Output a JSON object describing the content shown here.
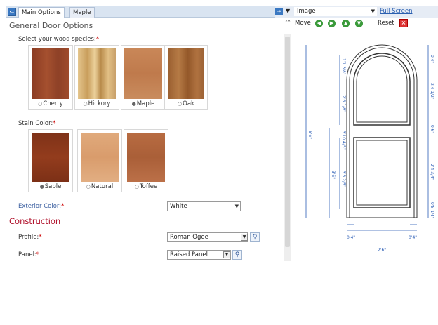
{
  "tabs": [
    {
      "label": "Main Options",
      "active": true
    },
    {
      "label": "Maple",
      "active": false
    }
  ],
  "section_title": "General Door Options",
  "species": {
    "label": "Select your wood species:",
    "required_mark": "*",
    "options": [
      {
        "label": "Cherry",
        "selected": false,
        "color": "#9a4a2a"
      },
      {
        "label": "Hickory",
        "selected": false,
        "color": "#d7b47a"
      },
      {
        "label": "Maple",
        "selected": true,
        "color": "#c9885a"
      },
      {
        "label": "Oak",
        "selected": false,
        "color": "#a86b3a"
      }
    ]
  },
  "stain": {
    "label": "Stain Color:",
    "required_mark": "*",
    "options": [
      {
        "label": "Sable",
        "selected": true,
        "color": "#8a3a1e"
      },
      {
        "label": "Natural",
        "selected": false,
        "color": "#dba274"
      },
      {
        "label": "Toffee",
        "selected": false,
        "color": "#b56a42"
      }
    ]
  },
  "exterior_color": {
    "label": "Exterior Color:",
    "required_mark": "*",
    "value": "White"
  },
  "construction": {
    "title": "Construction",
    "profile": {
      "label": "Profile:",
      "required_mark": "*",
      "value": "Roman Ogee"
    },
    "panel": {
      "label": "Panel:",
      "required_mark": "*",
      "value": "Raised Panel"
    }
  },
  "viewer": {
    "view_value": "Image",
    "full_screen": "Full Screen",
    "move_label": "Move",
    "reset_label": "Reset"
  },
  "drawing": {
    "dims": {
      "top": "0'4\"",
      "upper_right": "2'4 1/2\"",
      "mid_right": "0'6\"",
      "lower_right": "2'4 3/4\"",
      "bottom_right": "0'8 1/4\"",
      "upper_left_a": "1'1 3/8\"",
      "upper_left_b": "2'6 1/8\"",
      "height": "6'6\"",
      "mid_left": "3'10 4/5\"",
      "lower_left_a": "3'6\"",
      "lower_left_b": "3'3 2/5\"",
      "stile_left": "0'4\"",
      "stile_right": "0'4\"",
      "width": "2'6\""
    }
  },
  "colors": {
    "accent_red": "#b0102a",
    "link_blue": "#2a5fb0",
    "tab_bg": "#d9e4f1"
  }
}
